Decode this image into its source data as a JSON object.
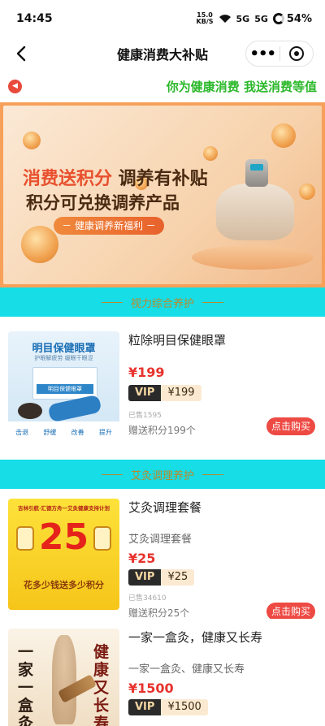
{
  "status_bar": {
    "time": "14:45",
    "net_rate": "15.0",
    "net_unit": "KB/S",
    "signal1": "5G",
    "signal2": "5G",
    "battery": "54%"
  },
  "nav": {
    "title": "健康消费大补贴",
    "more_icon": "more-dots-icon",
    "target_icon": "target-icon"
  },
  "notice": {
    "text": "你为健康消费 我送消费等值"
  },
  "banner": {
    "line1_highlight": "消费送积分",
    "line1_rest": " 调养有补贴",
    "line2": "积分可兑换调养产品",
    "pill": "－ 健康调养新福利 －"
  },
  "sections": [
    {
      "title": "视力综合养护",
      "products": [
        {
          "name": "粒除明目保健眼罩",
          "subtitle": "",
          "price": "¥199",
          "vip_label": "VIP",
          "vip_price": "¥199",
          "sold": "已售1595",
          "points": "赠送积分199个",
          "buy_label": "点击购买",
          "thumb": {
            "title": "明目保健眼罩",
            "sub": "护眼解疲劳 缓眼干眼涩",
            "box": "明目保健眼罩",
            "features": [
              "击退",
              "舒缓",
              "改善",
              "提升"
            ]
          }
        }
      ]
    },
    {
      "title": "艾灸调理养护",
      "products": [
        {
          "name": "艾灸调理套餐",
          "subtitle": "艾灸调理套餐",
          "price": "¥25",
          "vip_label": "VIP",
          "vip_price": "¥25",
          "sold": "已售34610",
          "points": "赠送积分25个",
          "buy_label": "点击购买",
          "thumb": {
            "header": "吉林引航·汇德方舟一艾灸健康支持计划",
            "big": "25",
            "slogan": "花多少钱送多少积分"
          }
        },
        {
          "name": "一家一盒灸，健康又长寿",
          "subtitle": "一家一盒灸、健康又长寿",
          "price": "¥1500",
          "vip_label": "VIP",
          "vip_price": "¥1500",
          "thumb": {
            "left": "一家一盒灸",
            "right": "健康又长寿"
          }
        }
      ]
    }
  ],
  "colors": {
    "section_bg": "#16dde6",
    "accent_red": "#e8322d",
    "notice_green": "#2bb82a",
    "banner_border": "#f6a05a"
  }
}
